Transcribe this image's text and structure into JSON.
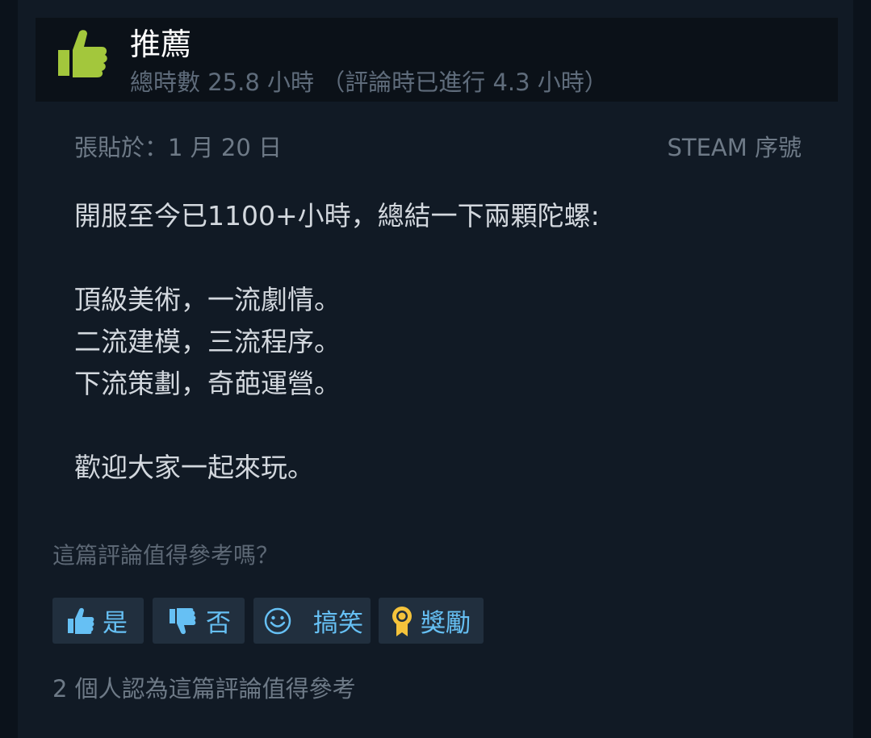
{
  "review": {
    "recommendation": "推薦",
    "hours": "總時數 25.8 小時 （評論時已進行 4.3 小時）",
    "posted": "張貼於：1 月 20 日",
    "source": "STEAM 序號",
    "body_lines": [
      "開服至今已1100+小時，總結一下兩顆陀螺:",
      "",
      "頂級美術，一流劇情。",
      "二流建模，三流程序。",
      "下流策劃，奇葩運營。",
      "",
      "歡迎大家一起來玩。"
    ]
  },
  "feedback": {
    "question": "這篇評論值得參考嗎？",
    "buttons": {
      "yes": "是",
      "no": "否",
      "funny": "搞笑",
      "award": "獎勵"
    },
    "helpful_count": "2 個人認為這篇評論值得參考"
  },
  "colors": {
    "page_background": "#0b121b",
    "card_background": "#111a25",
    "header_background": "#0b1118",
    "thumb_up_green": "#a3c73c",
    "button_background": "#212f3e",
    "button_text": "#66c0f4",
    "award_gold": "#f5c33b"
  },
  "icons": {
    "recommend": "thumbs-up-icon",
    "yes": "thumbs-up-icon",
    "no": "thumbs-down-icon",
    "funny": "smiley-icon",
    "award": "award-ribbon-icon"
  }
}
